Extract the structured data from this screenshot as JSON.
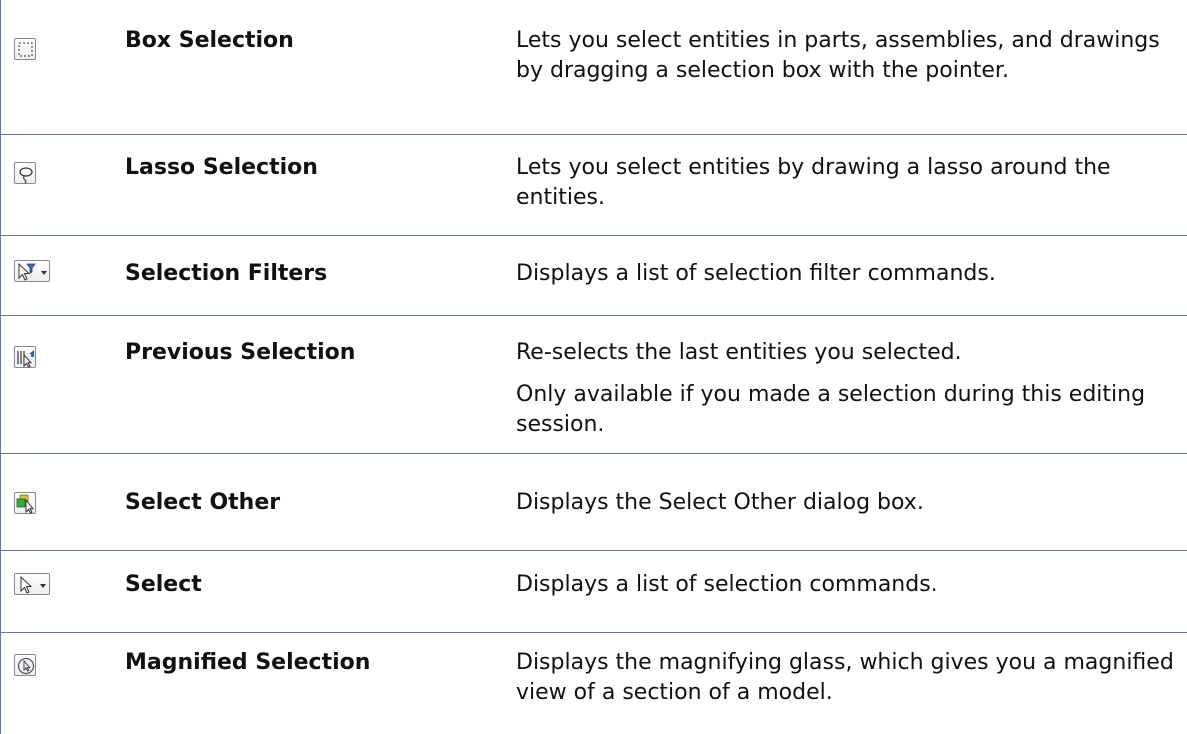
{
  "rows": [
    {
      "icon": "box-selection-icon",
      "name": "Box Selection",
      "description": [
        "Lets you select entities in parts, assemblies, and drawings by dragging a selection box with the pointer."
      ]
    },
    {
      "icon": "lasso-selection-icon",
      "name": "Lasso Selection",
      "description": [
        "Lets you select entities by drawing a lasso around the entities."
      ]
    },
    {
      "icon": "selection-filters-icon",
      "name": "Selection Filters",
      "description": [
        "Displays a list of selection filter commands."
      ]
    },
    {
      "icon": "previous-selection-icon",
      "name": "Previous Selection",
      "description": [
        "Re-selects the last entities you selected.",
        "Only available if you made a selection during this editing session."
      ]
    },
    {
      "icon": "select-other-icon",
      "name": "Select Other",
      "description": [
        "Displays the Select Other dialog box."
      ]
    },
    {
      "icon": "select-icon",
      "name": "Select",
      "description": [
        "Displays a list of selection commands."
      ]
    },
    {
      "icon": "magnified-selection-icon",
      "name": "Magnified Selection",
      "description": [
        "Displays the magnifying glass, which gives you a magnified view of a section of a model."
      ]
    }
  ],
  "colors": {
    "border": "#5a7aa6",
    "text": "#111111"
  }
}
